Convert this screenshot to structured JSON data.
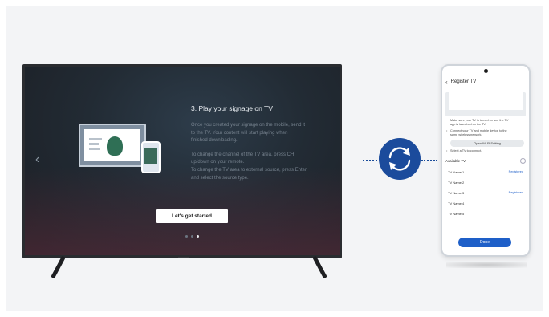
{
  "tv": {
    "title": "3. Play your signage on TV",
    "paragraph1": [
      "Once you created your signage on the mobile, send it",
      "to the TV. Your content will start playing when",
      "finished downloading."
    ],
    "paragraph2": [
      "To change the channel of the TV area, press CH",
      "up/down on your remote.",
      "To change the TV area to external source, press Enter",
      "and select the source type."
    ],
    "cta_label": "Let's get started",
    "prev_arrow": "‹",
    "page_dots": 3,
    "active_dot": 3
  },
  "phone": {
    "back_icon": "‹",
    "title": "Register TV",
    "note1": [
      "Make sure your TV is turned on and the TV",
      "app is launched on the TV."
    ],
    "note2": [
      "Connect your TV and mobile device to the",
      "same wireless network."
    ],
    "wifi_button": "Open Wi-Fi Setting",
    "note3": "Select a TV to connect.",
    "available_label": "Available TV",
    "tv_list": [
      {
        "name": "TV Name 1",
        "status": "Registered"
      },
      {
        "name": "TV Name 2",
        "status": ""
      },
      {
        "name": "TV Name 3",
        "status": "Registered"
      },
      {
        "name": "TV Name 4",
        "status": ""
      },
      {
        "name": "TV Name 5",
        "status": ""
      }
    ],
    "done_label": "Done"
  },
  "colors": {
    "sync_blue": "#1b4b9c",
    "done_blue": "#1e5fc8"
  },
  "icons": [
    "chevron-left-icon",
    "sync-icon",
    "back-icon",
    "refresh-icon"
  ]
}
